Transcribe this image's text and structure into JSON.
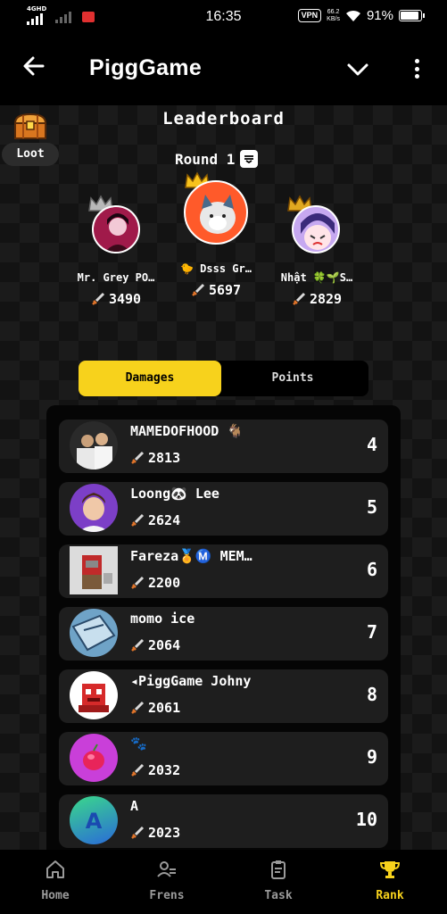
{
  "status_bar": {
    "network": "4GHD",
    "time": "16:35",
    "vpn": "VPN",
    "speed_value": "66.2",
    "speed_unit": "KB/s",
    "battery": "91%"
  },
  "header": {
    "title": "PiggGame",
    "back_icon": "arrow-left-icon",
    "dropdown_icon": "chevron-down-icon",
    "menu_icon": "more-vertical-icon"
  },
  "loot": {
    "label": "Loot",
    "icon": "treasure-chest-icon"
  },
  "leaderboard": {
    "title": "Leaderboard",
    "round_label": "Round 1",
    "podium": [
      {
        "place": 2,
        "name": "Mr. Grey PO…",
        "score": "3490",
        "crown": "silver"
      },
      {
        "place": 1,
        "name": "🐤 Dsss Gr…",
        "score": "5697",
        "crown": "gold"
      },
      {
        "place": 3,
        "name": "Nhật 🍀🌱S…",
        "score": "2829",
        "crown": "gold"
      }
    ]
  },
  "tabs": [
    {
      "label": "Damages",
      "active": true
    },
    {
      "label": "Points",
      "active": false
    }
  ],
  "ranking": [
    {
      "name": "MAMEDOFHOOD 🐐",
      "score": "2813",
      "rank": "4",
      "avatar_color": "#2a2a2a"
    },
    {
      "name": "Loong🐼 Lee",
      "score": "2624",
      "rank": "5",
      "avatar_color": "#7c3fc7"
    },
    {
      "name": "Fareza🏅Ⓜ️ MEM…",
      "score": "2200",
      "rank": "6",
      "avatar_color": "#dcdcdc"
    },
    {
      "name": "momo ice",
      "score": "2064",
      "rank": "7",
      "avatar_color": "#6fa3c7"
    },
    {
      "name": "◂PiggGame Johny",
      "score": "2061",
      "rank": "8",
      "avatar_color": "#ffffff"
    },
    {
      "name": "🐾",
      "score": "2032",
      "rank": "9",
      "avatar_color": "#c93fd9"
    },
    {
      "name": "A",
      "score": "2023",
      "rank": "10",
      "avatar_color": "#29c6c9"
    }
  ],
  "bottom_nav": [
    {
      "label": "Home",
      "icon": "home-icon",
      "active": false
    },
    {
      "label": "Frens",
      "icon": "friends-icon",
      "active": false
    },
    {
      "label": "Task",
      "icon": "clipboard-icon",
      "active": false
    },
    {
      "label": "Rank",
      "icon": "trophy-icon",
      "active": true
    }
  ],
  "colors": {
    "accent": "#f7d21c",
    "background": "#000000",
    "row": "#1e1e1e"
  }
}
